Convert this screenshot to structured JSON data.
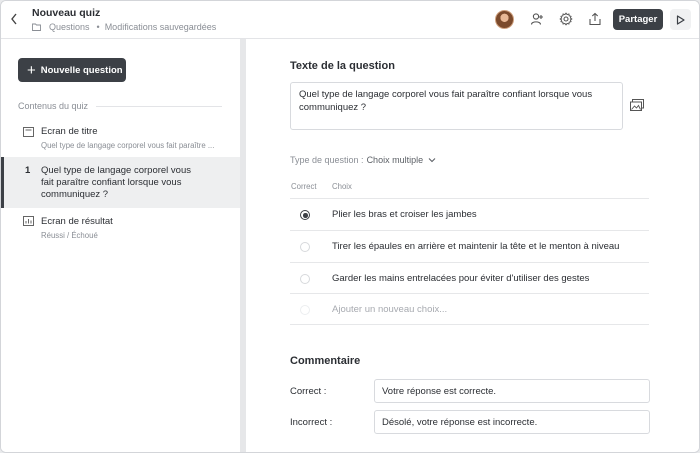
{
  "header": {
    "title": "Nouveau quiz",
    "breadcrumb_folder": "Questions",
    "status": "Modifications sauvegardées",
    "share_label": "Partager"
  },
  "icons": [
    "back-icon",
    "folder-icon",
    "avatar",
    "add-user-icon",
    "gear-icon",
    "export-icon",
    "play-icon",
    "plus-icon",
    "title-screen-icon",
    "result-screen-icon",
    "image-icon",
    "chevron-down-icon"
  ],
  "sidebar": {
    "new_question_label": "Nouvelle question",
    "contents_label": "Contenus du quiz",
    "items": [
      {
        "name": "Ecran de titre",
        "sub": "Quel type de langage corporel vous fait paraître ..."
      },
      {
        "number": "1",
        "name": "Quel type de langage corporel vous fait paraître confiant lorsque vous communiquez ?"
      },
      {
        "name": "Ecran de résultat",
        "sub": "Réussi / Échoué"
      }
    ]
  },
  "main": {
    "question_heading": "Texte de la question",
    "question_text": "Quel type de langage corporel vous fait paraître confiant lorsque vous communiquez ?",
    "question_type_label": "Type de question :",
    "question_type_value": "Choix multiple",
    "col_correct": "Correct",
    "col_choice": "Choix",
    "choices": [
      {
        "text": "Plier les bras et croiser les jambes",
        "correct": true
      },
      {
        "text": "Tirer les épaules en arrière et maintenir la tête et le menton à niveau",
        "correct": false
      },
      {
        "text": "Garder les mains entrelacées pour éviter d'utiliser des gestes",
        "correct": false
      }
    ],
    "add_choice_placeholder": "Ajouter un nouveau choix...",
    "feedback_heading": "Commentaire",
    "feedback": {
      "correct_label": "Correct :",
      "correct_value": "Votre réponse est correcte.",
      "incorrect_label": "Incorrect :",
      "incorrect_value": "Désolé, votre réponse est incorrecte."
    }
  },
  "colors": {
    "accent": "#3c4046",
    "muted_text": "#8a8e95",
    "border": "#d8dade"
  }
}
